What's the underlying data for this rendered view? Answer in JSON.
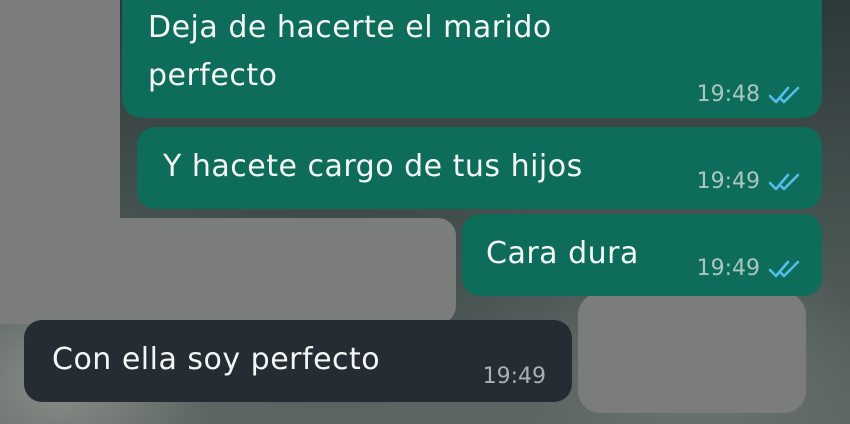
{
  "messages": [
    {
      "text_line1": "Deja de hacerte el marido",
      "text_line2": "perfecto",
      "time": "19:48",
      "status": "read"
    },
    {
      "text": "Y hacete cargo de tus hijos",
      "time": "19:49",
      "status": "read"
    },
    {
      "text": "Cara dura",
      "time": "19:49",
      "status": "read"
    },
    {
      "text": "Con ella soy perfecto",
      "time": "19:49"
    }
  ],
  "colors": {
    "outgoing_bubble": "#0e6d5a",
    "incoming_bubble": "#232d33",
    "read_ticks": "#53bdeb"
  },
  "icons": {
    "read_receipt": "double-check-icon"
  }
}
